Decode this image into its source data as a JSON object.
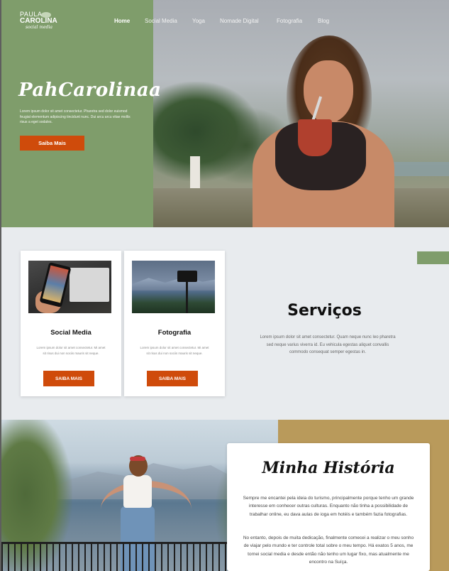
{
  "logo": {
    "line1": "PAULA",
    "line2": "CAROLINA",
    "line3": "social media"
  },
  "nav": {
    "items": [
      {
        "label": "Home",
        "active": true
      },
      {
        "label": "Social Media",
        "active": false
      },
      {
        "label": "Yoga",
        "active": false
      },
      {
        "label": "Nomade Digital",
        "active": false
      },
      {
        "label": "Fotografia",
        "active": false
      },
      {
        "label": "Blog",
        "active": false
      }
    ]
  },
  "hero": {
    "title": "PahCarolinaa",
    "text": "Lorem ipsum dolor sit amet consectetur. Pharetra sed dolor euismod feugiat elementum adipiscing tincidunt nunc. Dui arcu arcu vitae mollis risus a eget sodales.",
    "button": "Saiba Mais"
  },
  "services": {
    "title": "Serviços",
    "text": "Lorem ipsum dolor sit amet consectetur. Quam neque nunc leo pharetra sed neque varius viverra id. Eu vehicula egestas aliquet convallis commodo consequat semper egestas in.",
    "cards": [
      {
        "title": "Social Media",
        "text": "Lorem ipsum dolor sit amet consectetur. Mi amet sit risus dui non sociis mauris sit neque.",
        "button": "SAIBA MAIS"
      },
      {
        "title": "Fotografia",
        "text": "Lorem ipsum dolor sit amet consectetur. Mi amet sit risus dui non sociis mauris sit neque.",
        "button": "SAIBA MAIS"
      }
    ]
  },
  "story": {
    "title": "Minha História",
    "p1": "Sempre me encantei pela ideia do turismo, principalmente porque tenho um grande interesse em conhecer outras culturas. Enquanto não tinha a possibilidade de trabalhar online, eu dava aulas de ioga em hotéis e também fazia fotografias.",
    "p2": "No entanto, depois de muita dedicação, finalmente comecei a realizar o meu sonho de viajar pelo mundo e ter controle total sobre o meu tempo. Há exatos 5 anos, me tornei social media e desde então não tenho um lugar fixo, mas atualmente me encontro na Suíça."
  },
  "colors": {
    "green": "#7f9d6b",
    "orange": "#cf4b0b",
    "tan": "#b99a5b",
    "light": "#e8ebee"
  }
}
